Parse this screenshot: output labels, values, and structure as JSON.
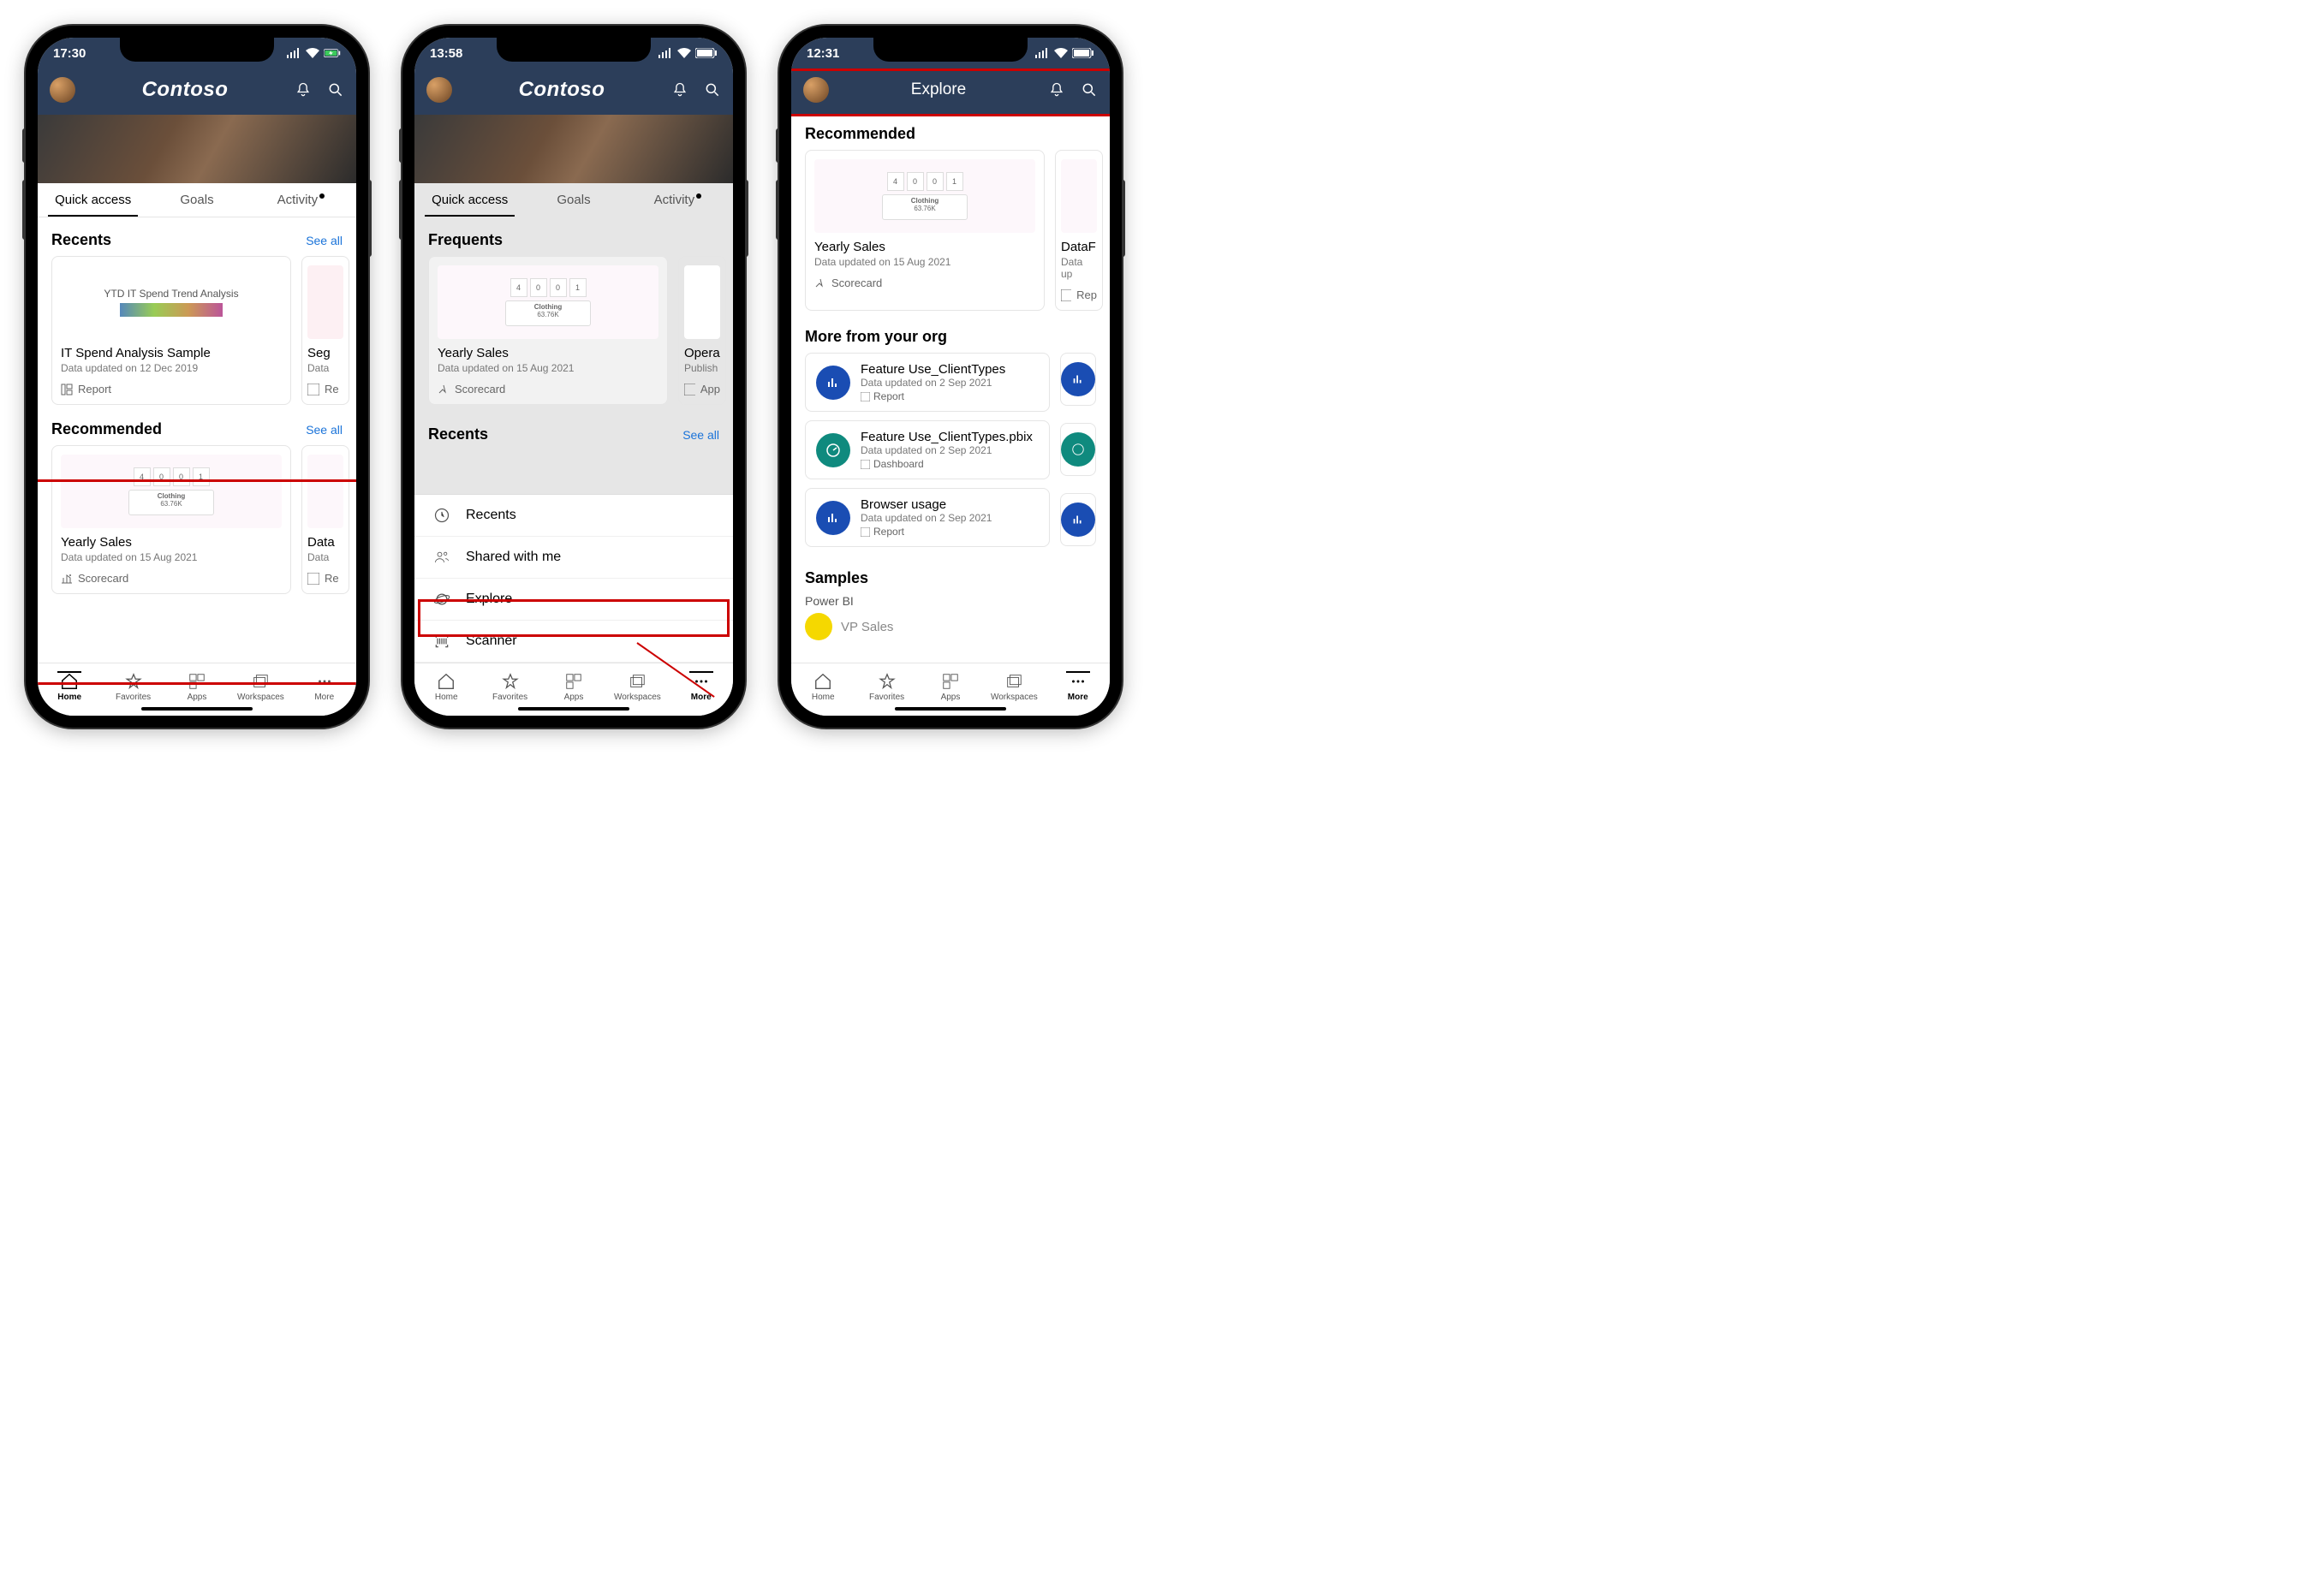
{
  "phone1": {
    "time": "17:30",
    "brand": "Contoso",
    "tabs": {
      "quick": "Quick access",
      "goals": "Goals",
      "activity": "Activity"
    },
    "recents": {
      "title": "Recents",
      "see_all": "See all",
      "card1": {
        "thumb_text": "YTD IT Spend Trend Analysis",
        "title": "IT Spend Analysis Sample",
        "sub": "Data updated on 12 Dec 2019",
        "type": "Report"
      },
      "partial": {
        "title_frag": "Seg",
        "sub_frag": "Data",
        "type_frag": "Re"
      }
    },
    "recommended": {
      "title": "Recommended",
      "see_all": "See all",
      "card1": {
        "title": "Yearly Sales",
        "sub": "Data updated on 15 Aug 2021",
        "type": "Scorecard",
        "kpi": [
          "4",
          "0",
          "0",
          "1"
        ],
        "mini_val": "63.76K"
      },
      "partial": {
        "title_frag": "Data",
        "sub_frag": "Data",
        "type_frag": "Re"
      }
    },
    "nav": {
      "home": "Home",
      "favorites": "Favorites",
      "apps": "Apps",
      "workspaces": "Workspaces",
      "more": "More"
    }
  },
  "phone2": {
    "time": "13:58",
    "brand": "Contoso",
    "tabs": {
      "quick": "Quick access",
      "goals": "Goals",
      "activity": "Activity"
    },
    "frequents": {
      "title": "Frequents",
      "card1": {
        "title": "Yearly Sales",
        "sub": "Data updated on 15 Aug 2021",
        "type": "Scorecard",
        "kpi": [
          "4",
          "0",
          "0",
          "1"
        ],
        "mini_val": "63.76K"
      },
      "partial": {
        "title_frag": "Opera",
        "sub_frag": "Publish",
        "type_frag": "App"
      }
    },
    "recents_label": "Recents",
    "recents_see_all": "See all",
    "more_menu": {
      "recents": "Recents",
      "shared": "Shared with me",
      "explore": "Explore",
      "scanner": "Scanner"
    },
    "nav": {
      "home": "Home",
      "favorites": "Favorites",
      "apps": "Apps",
      "workspaces": "Workspaces",
      "more": "More"
    }
  },
  "phone3": {
    "time": "12:31",
    "title": "Explore",
    "recommended": {
      "title": "Recommended",
      "card1": {
        "title": "Yearly Sales",
        "sub": "Data updated on 15 Aug 2021",
        "type": "Scorecard",
        "kpi": [
          "4",
          "0",
          "0",
          "1"
        ],
        "mini_val": "63.76K"
      },
      "partial": {
        "title_frag": "DataF",
        "sub_frag": "Data up",
        "type_frag": "Rep"
      }
    },
    "more_org": {
      "title": "More from your org",
      "items": [
        {
          "t": "Feature Use_ClientTypes",
          "s": "Data updated on 2 Sep 2021",
          "k": "Report",
          "icon": "chart"
        },
        {
          "t": "Feature Use_ClientTypes.pbix",
          "s": "Data updated on 2 Sep 2021",
          "k": "Dashboard",
          "icon": "dash"
        },
        {
          "t": "Browser usage",
          "s": "Data updated on 2 Sep 2021",
          "k": "Report",
          "icon": "chart"
        }
      ]
    },
    "samples": {
      "title": "Samples",
      "sub": "Power BI",
      "item": "VP Sales"
    },
    "nav": {
      "home": "Home",
      "favorites": "Favorites",
      "apps": "Apps",
      "workspaces": "Workspaces",
      "more": "More"
    }
  }
}
